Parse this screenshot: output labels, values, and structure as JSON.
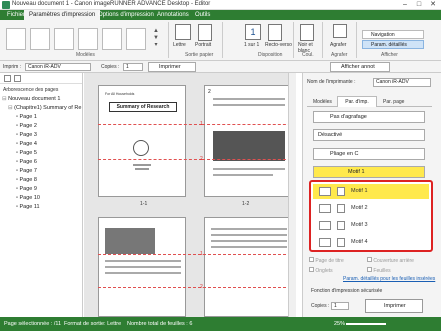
{
  "window": {
    "title": "Nouveau document 1 - Canon imageRUNNER ADVANCE Desktop - Editor"
  },
  "tabs": [
    "Fichier",
    "Paramètres d'impression",
    "Options d'impression",
    "Annotations",
    "Outils"
  ],
  "ribbon": {
    "groups": {
      "modeles": "Modèles",
      "sortie": "Sortie papier",
      "disposition": "Disposition",
      "coul": "Coul.",
      "agrafer": "Agrafer",
      "afficher": "Afficher"
    },
    "buttons": {
      "lettre": "Lettre",
      "portrait": "Portrait",
      "recto_verso": "Recto-verso",
      "noir_blanc": "Noir et blanc",
      "agrafer": "Agrafer",
      "un_sur": "1 sur 1",
      "navigation": "Navigation",
      "param_details": "Param. détaillés"
    }
  },
  "toolbar": {
    "imprim_label": "Imprim :",
    "printer": "Canon iR-ADV",
    "copies_label": "Copies :",
    "copies": "1",
    "imprimer": "Imprimer",
    "afficher_annot": "Afficher annot"
  },
  "left": {
    "header": "Arborescence des pages",
    "root": "Nouveau document 1",
    "chapter": "(Chapitre1) Summary of Re",
    "pages": [
      "Page 1",
      "Page 2",
      "Page 3",
      "Page 4",
      "Page 5",
      "Page 6",
      "Page 7",
      "Page 8",
      "Page 9",
      "Page 10",
      "Page 11"
    ]
  },
  "preview": {
    "page1_header": "For All Households",
    "page1_title": "Summary of Research",
    "page1_sub": "1-1",
    "page2_sub": "1-2",
    "nums": [
      "1",
      "2",
      "1",
      "2"
    ]
  },
  "right": {
    "printer_label": "Nom de l'imprimante :",
    "printer": "Canon iR-ADV",
    "tabs": [
      "Modèles",
      "Par. d'imp.",
      "Par. page"
    ],
    "agrafage": "Pas d'agrafage",
    "desactive": "Désactivé",
    "pliage": "Pliage en C",
    "selected": "Motif 1",
    "motifs": [
      "Motif 1",
      "Motif 2",
      "Motif 3",
      "Motif 4"
    ],
    "chk_page_titre": "Page de titre",
    "chk_couverture": "Couverture arrière",
    "chk_onglets": "Onglets",
    "chk_feuilles": "Feuilles",
    "link": "Param. détaillés pour les feuilles insérées",
    "secure_label": "Fonction d'impression sécurisée",
    "copies_label": "Copies :",
    "copies": "1",
    "imprimer": "Imprimer"
  },
  "status": {
    "selected": "Page sélectionnée : /11",
    "format": "Format de sortie: Lettre",
    "total": "Nombre total de feuilles : 6",
    "zoom": "25%"
  }
}
